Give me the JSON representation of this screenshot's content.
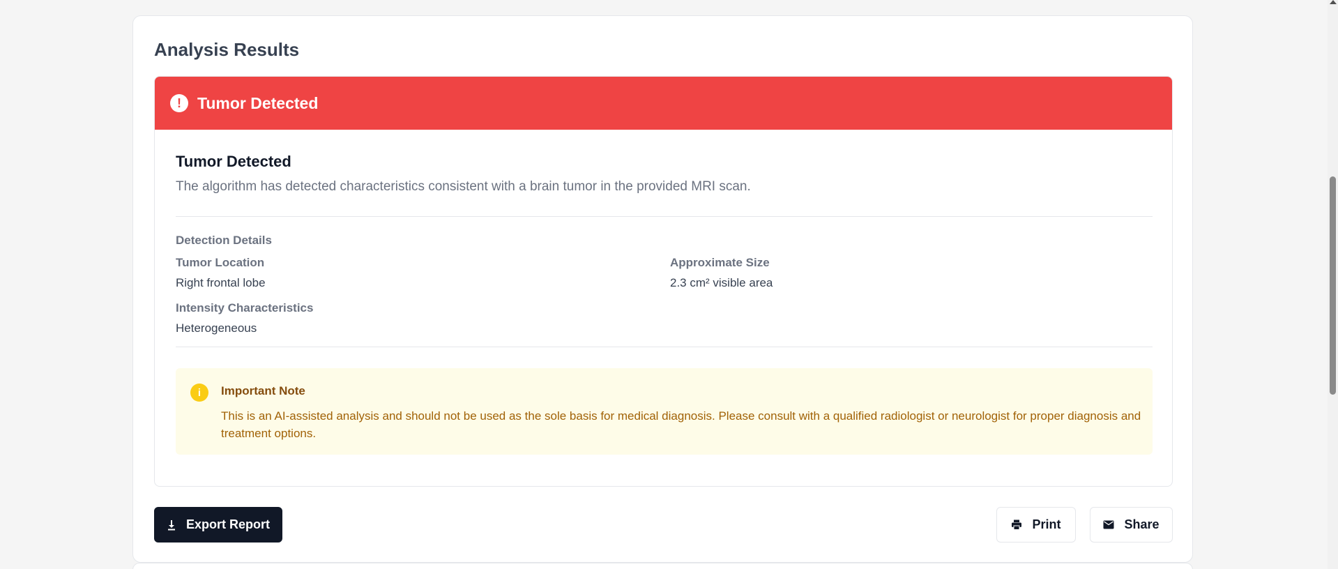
{
  "panel": {
    "title": "Analysis Results"
  },
  "result": {
    "banner_title": "Tumor Detected",
    "heading": "Tumor Detected",
    "description": "The algorithm has detected characteristics consistent with a brain tumor in the provided MRI scan.",
    "status_color": "#ef4444"
  },
  "details": {
    "title": "Detection Details",
    "items": [
      {
        "label": "Tumor Location",
        "value": "Right frontal lobe"
      },
      {
        "label": "Approximate Size",
        "value": "2.3 cm² visible area"
      },
      {
        "label": "Intensity Characteristics",
        "value": "Heterogeneous"
      }
    ]
  },
  "note": {
    "title": "Important Note",
    "text": "This is an AI-assisted analysis and should not be used as the sole basis for medical diagnosis. Please consult with a qualified radiologist or neurologist for proper diagnosis and treatment options.",
    "icon": "info-icon"
  },
  "actions": {
    "export_label": "Export Report",
    "print_label": "Print",
    "share_label": "Share"
  }
}
